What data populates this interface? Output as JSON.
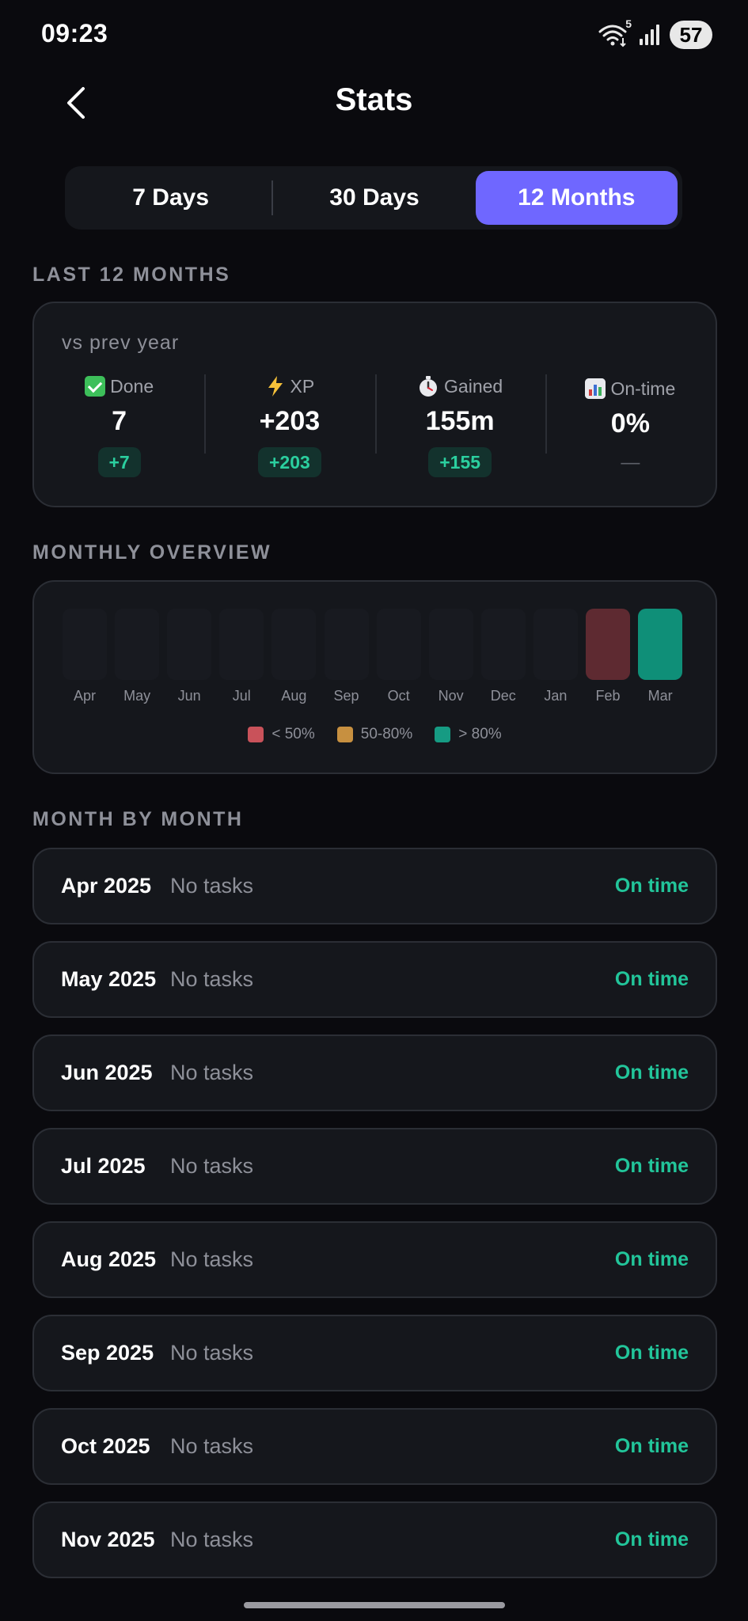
{
  "status_bar": {
    "time": "09:23",
    "wifi_badge": "5",
    "battery": "57"
  },
  "header": {
    "title": "Stats"
  },
  "tabs": [
    {
      "label": "7 Days",
      "active": false
    },
    {
      "label": "30 Days",
      "active": false
    },
    {
      "label": "12 Months",
      "active": true
    }
  ],
  "summary": {
    "section_label": "LAST 12 MONTHS",
    "compare_label": "vs prev year",
    "stats": [
      {
        "label": "Done",
        "icon": "check-icon",
        "value": "7",
        "delta": "+7"
      },
      {
        "label": "XP",
        "icon": "lightning-icon",
        "value": "+203",
        "delta": "+203"
      },
      {
        "label": "Gained",
        "icon": "stopwatch-icon",
        "value": "155m",
        "delta": "+155"
      },
      {
        "label": "On-time",
        "icon": "bar-chart-icon",
        "value": "0%",
        "delta": "—"
      }
    ]
  },
  "overview": {
    "section_label": "MONTHLY OVERVIEW",
    "months": [
      "Apr",
      "May",
      "Jun",
      "Jul",
      "Aug",
      "Sep",
      "Oct",
      "Nov",
      "Dec",
      "Jan",
      "Feb",
      "Mar"
    ],
    "bar_status": [
      "empty",
      "empty",
      "empty",
      "empty",
      "empty",
      "empty",
      "empty",
      "empty",
      "empty",
      "empty",
      "low",
      "high"
    ],
    "legend": [
      {
        "label": "< 50%",
        "color": "#c9525a"
      },
      {
        "label": "50-80%",
        "color": "#c79040"
      },
      {
        "label": "> 80%",
        "color": "#169b83"
      }
    ],
    "colors": {
      "low_bar": "#5e2a31",
      "high_bar": "#0f8f78",
      "empty_bar": "#181a20"
    }
  },
  "month_by_month": {
    "section_label": "MONTH BY MONTH",
    "rows": [
      {
        "month": "Apr 2025",
        "tasks": "No tasks",
        "status": "On time"
      },
      {
        "month": "May 2025",
        "tasks": "No tasks",
        "status": "On time"
      },
      {
        "month": "Jun 2025",
        "tasks": "No tasks",
        "status": "On time"
      },
      {
        "month": "Jul 2025",
        "tasks": "No tasks",
        "status": "On time"
      },
      {
        "month": "Aug 2025",
        "tasks": "No tasks",
        "status": "On time"
      },
      {
        "month": "Sep 2025",
        "tasks": "No tasks",
        "status": "On time"
      },
      {
        "month": "Oct 2025",
        "tasks": "No tasks",
        "status": "On time"
      },
      {
        "month": "Nov 2025",
        "tasks": "No tasks",
        "status": "On time"
      }
    ]
  },
  "colors": {
    "background": "#0a0a0e",
    "card": "#15171c",
    "accent": "#6f67ff",
    "success": "#22c59a"
  }
}
